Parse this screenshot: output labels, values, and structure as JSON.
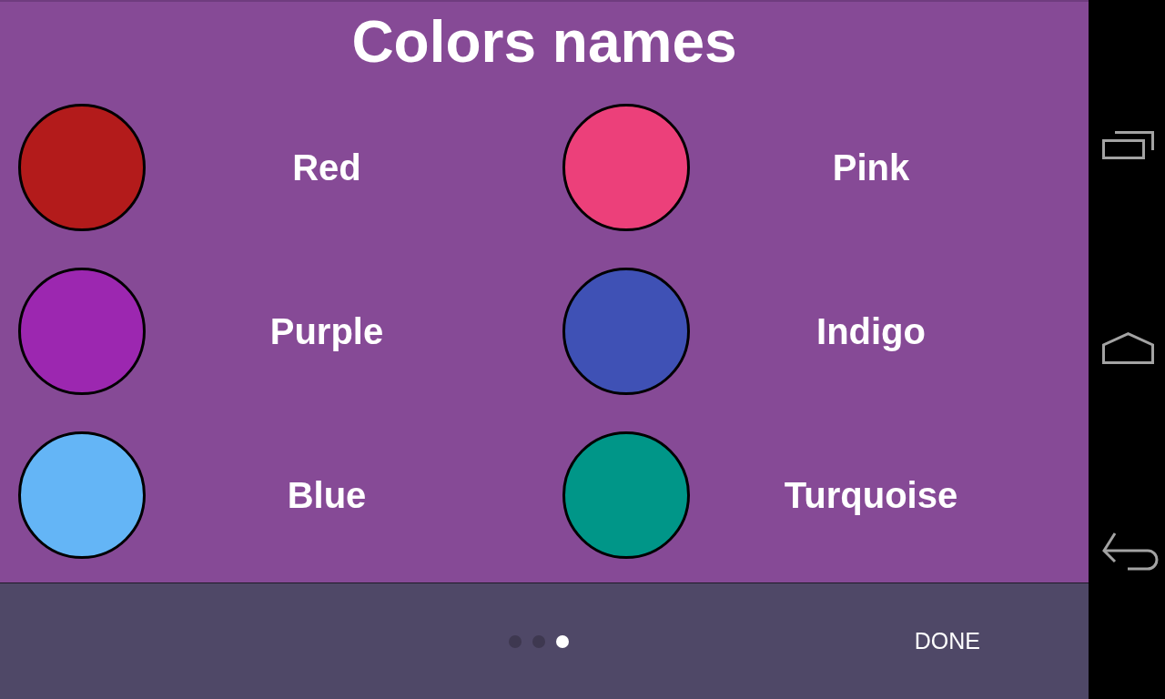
{
  "title": "Colors names",
  "colors": [
    {
      "name": "Red",
      "color": "#b31b1b"
    },
    {
      "name": "Pink",
      "color": "#ec407a"
    },
    {
      "name": "Purple",
      "color": "#9c27b0"
    },
    {
      "name": "Indigo",
      "color": "#3f51b5"
    },
    {
      "name": "Blue",
      "color": "#64b5f6"
    },
    {
      "name": "Turquoise",
      "color": "#009688"
    }
  ],
  "pager": [
    {
      "selected": false
    },
    {
      "selected": false
    },
    {
      "selected": true
    }
  ],
  "done_button": {
    "label": "DONE"
  }
}
